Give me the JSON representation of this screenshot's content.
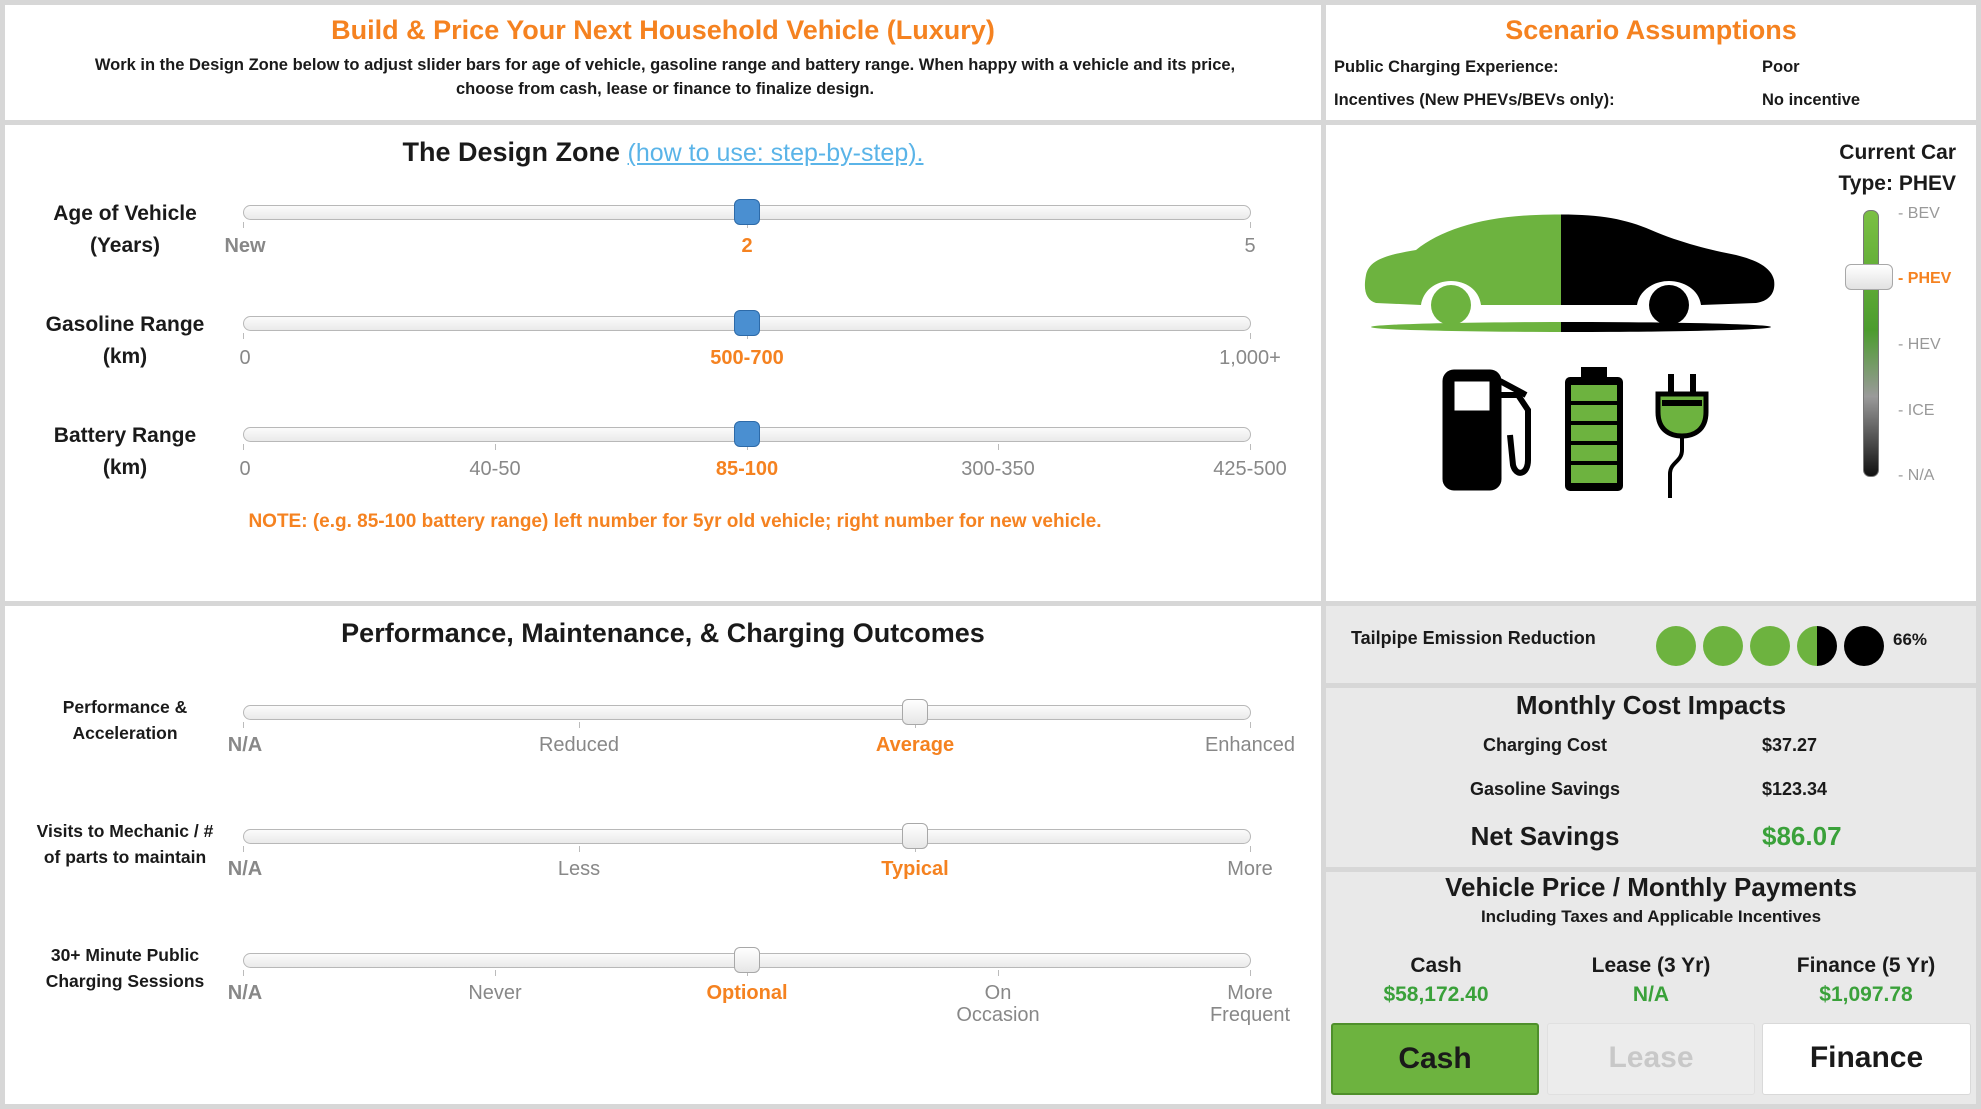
{
  "header": {
    "title": "Build & Price Your Next Household Vehicle (Luxury)",
    "description": "Work in the Design Zone below to adjust slider bars for age of vehicle, gasoline range and battery range. When happy with a vehicle and its price, choose from cash, lease or finance to finalize design."
  },
  "scenario": {
    "title": "Scenario Assumptions",
    "rows": [
      {
        "label": "Public Charging Experience:",
        "value": "Poor"
      },
      {
        "label": "Incentives (New PHEVs/BEVs only):",
        "value": "No incentive"
      }
    ]
  },
  "design_zone": {
    "title": "The Design Zone",
    "link_text": "(how to use: step-by-step).",
    "sliders": [
      {
        "label_line1": "Age of Vehicle",
        "label_line2": "(Years)",
        "scale": [
          "New",
          "2",
          "5"
        ],
        "selected": "2",
        "value": 0.5
      },
      {
        "label_line1": "Gasoline Range",
        "label_line2": "(km)",
        "scale": [
          "0",
          "500-700",
          "1,000+"
        ],
        "selected": "500-700",
        "value": 0.5
      },
      {
        "label_line1": "Battery Range",
        "label_line2": "(km)",
        "scale": [
          "0",
          "40-50",
          "85-100",
          "300-350",
          "425-500"
        ],
        "selected": "85-100",
        "value": 0.5
      }
    ],
    "note": "NOTE: (e.g. 85-100 battery range) left number for 5yr old vehicle; right number for new vehicle."
  },
  "car_panel": {
    "current_label_line1": "Current Car",
    "current_label_line2": "Type: PHEV",
    "types": [
      "- BEV",
      "- PHEV",
      "- HEV",
      "- ICE",
      "- N/A"
    ],
    "selected_type": "- PHEV",
    "icons": [
      "car-icon",
      "fuel-pump-icon",
      "battery-icon",
      "plug-icon"
    ]
  },
  "outcomes": {
    "title": "Performance, Maintenance, & Charging Outcomes",
    "sliders": [
      {
        "label_line1": "Performance &",
        "label_line2": "Acceleration",
        "scale": [
          "N/A",
          "Reduced",
          "Average",
          "Enhanced"
        ],
        "selected": "Average",
        "value": 0.667
      },
      {
        "label_line1": "Visits to Mechanic / #",
        "label_line2": "of parts to maintain",
        "scale": [
          "N/A",
          "Less",
          "Typical",
          "More"
        ],
        "selected": "Typical",
        "value": 0.667
      },
      {
        "label_line1": "30+ Minute Public",
        "label_line2": "Charging Sessions",
        "scale": [
          "N/A",
          "Never",
          "Optional",
          "On Occasion",
          "More Frequent"
        ],
        "selected": "Optional",
        "value": 0.5
      }
    ]
  },
  "emission": {
    "label": "Tailpipe Emission Reduction",
    "value": "66%",
    "circles": [
      "full",
      "full",
      "full",
      "half",
      "empty"
    ]
  },
  "monthly": {
    "title": "Monthly Cost Impacts",
    "charging_label": "Charging Cost",
    "charging_value": "$37.27",
    "gasoline_label": "Gasoline Savings",
    "gasoline_value": "$123.34",
    "net_label": "Net Savings",
    "net_value": "$86.07"
  },
  "price": {
    "title": "Vehicle Price / Monthly Payments",
    "subtitle": "Including Taxes and Applicable Incentives",
    "options": [
      {
        "label": "Cash",
        "value": "$58,172.40",
        "button": "Cash",
        "state": "selected"
      },
      {
        "label": "Lease (3 Yr)",
        "value": "N/A",
        "button": "Lease",
        "state": "disabled"
      },
      {
        "label": "Finance (5 Yr)",
        "value": "$1,097.78",
        "button": "Finance",
        "state": "normal"
      }
    ]
  },
  "colors": {
    "accent": "#f58220",
    "green": "#3aa13a",
    "car_green": "#6db33f",
    "link": "#5ab4e8",
    "slider_blue": "#4a8fd1"
  }
}
